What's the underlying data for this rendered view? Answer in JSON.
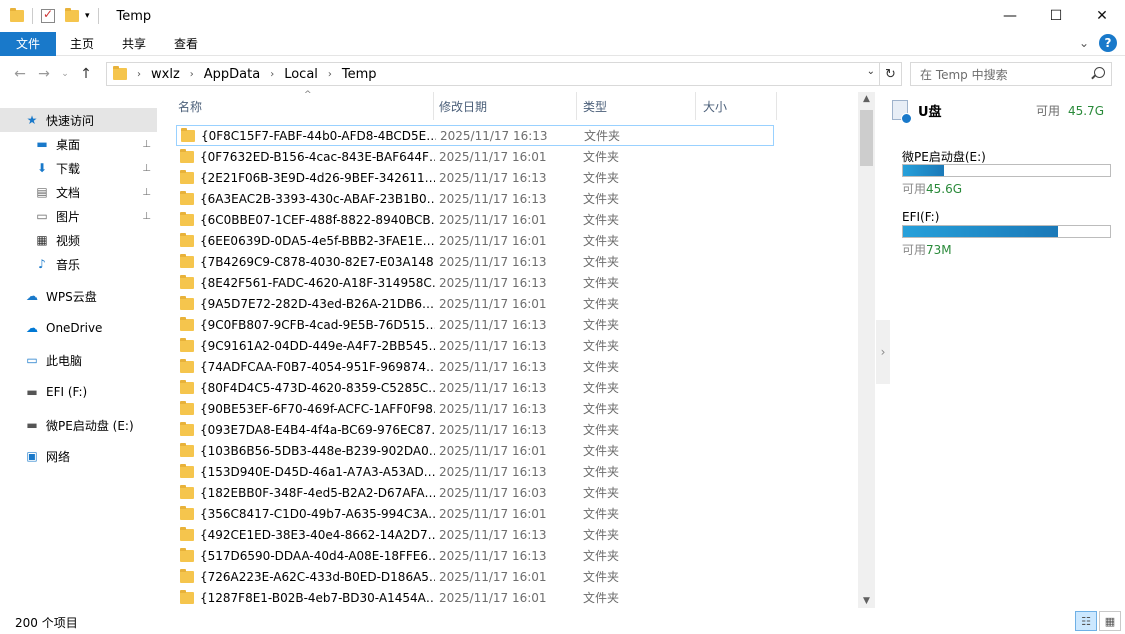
{
  "window": {
    "title": "Temp",
    "controls": {
      "minimize": "—",
      "maximize": "☐",
      "close": "✕"
    }
  },
  "ribbon": {
    "tabs": [
      {
        "label": "文件",
        "active": true
      },
      {
        "label": "主页"
      },
      {
        "label": "共享"
      },
      {
        "label": "查看"
      }
    ],
    "expand_glyph": "⌄",
    "help": "?"
  },
  "nav": {
    "back": "←",
    "forward": "→",
    "recent": "⌄",
    "up": "↑",
    "breadcrumb": [
      "wxlz",
      "AppData",
      "Local",
      "Temp"
    ],
    "breadcrumb_sep": "›",
    "refresh": "↻",
    "search_placeholder": "在 Temp 中搜索"
  },
  "sidebar": {
    "items": [
      {
        "label": "快速访问",
        "icon": "star-icon",
        "glyph": "★",
        "color": "#1979ca",
        "selected": true
      },
      {
        "label": "桌面",
        "icon": "desktop-icon",
        "glyph": "▬",
        "color": "#1979ca",
        "pinned": true
      },
      {
        "label": "下载",
        "icon": "download-icon",
        "glyph": "⬇",
        "color": "#1979ca",
        "pinned": true
      },
      {
        "label": "文档",
        "icon": "document-icon",
        "glyph": "▤",
        "color": "#666666",
        "pinned": true
      },
      {
        "label": "图片",
        "icon": "pictures-icon",
        "glyph": "▭",
        "color": "#666666",
        "pinned": true
      },
      {
        "label": "视频",
        "icon": "video-icon",
        "glyph": "▦",
        "color": "#333333"
      },
      {
        "label": "音乐",
        "icon": "music-icon",
        "glyph": "♪",
        "color": "#1979ca"
      },
      {
        "label": "WPS云盘",
        "icon": "cloud-icon",
        "glyph": "☁",
        "color": "#1979ca"
      },
      {
        "label": "OneDrive",
        "icon": "onedrive-icon",
        "glyph": "☁",
        "color": "#0078d4"
      },
      {
        "label": "此电脑",
        "icon": "computer-icon",
        "glyph": "▭",
        "color": "#1979ca"
      },
      {
        "label": "EFI (F:)",
        "icon": "drive-icon",
        "glyph": "▬",
        "color": "#555555"
      },
      {
        "label": "微PE启动盘 (E:)",
        "icon": "drive-icon",
        "glyph": "▬",
        "color": "#555555"
      },
      {
        "label": "网络",
        "icon": "network-icon",
        "glyph": "▣",
        "color": "#1979ca"
      }
    ],
    "pin_glyph": "📌"
  },
  "columns": {
    "name": "名称",
    "date": "修改日期",
    "type": "类型",
    "size": "大小"
  },
  "files": [
    {
      "name": "{0F8C15F7-FABF-44b0-AFD8-4BCD5E…",
      "date": "2025/11/17 16:13",
      "type": "文件夹"
    },
    {
      "name": "{0F7632ED-B156-4cac-843E-BAF644F…",
      "date": "2025/11/17 16:01",
      "type": "文件夹"
    },
    {
      "name": "{2E21F06B-3E9D-4d26-9BEF-342611…",
      "date": "2025/11/17 16:13",
      "type": "文件夹"
    },
    {
      "name": "{6A3EAC2B-3393-430c-ABAF-23B1B0…",
      "date": "2025/11/17 16:13",
      "type": "文件夹"
    },
    {
      "name": "{6C0BBE07-1CEF-488f-8822-8940BCB…",
      "date": "2025/11/17 16:01",
      "type": "文件夹"
    },
    {
      "name": "{6EE0639D-0DA5-4e5f-BBB2-3FAE1E…",
      "date": "2025/11/17 16:01",
      "type": "文件夹"
    },
    {
      "name": "{7B4269C9-C878-4030-82E7-E03A148…",
      "date": "2025/11/17 16:13",
      "type": "文件夹"
    },
    {
      "name": "{8E42F561-FADC-4620-A18F-314958C…",
      "date": "2025/11/17 16:13",
      "type": "文件夹"
    },
    {
      "name": "{9A5D7E72-282D-43ed-B26A-21DB6…",
      "date": "2025/11/17 16:01",
      "type": "文件夹"
    },
    {
      "name": "{9C0FB807-9CFB-4cad-9E5B-76D515…",
      "date": "2025/11/17 16:13",
      "type": "文件夹"
    },
    {
      "name": "{9C9161A2-04DD-449e-A4F7-2BB545…",
      "date": "2025/11/17 16:13",
      "type": "文件夹"
    },
    {
      "name": "{74ADFCAA-F0B7-4054-951F-969874…",
      "date": "2025/11/17 16:13",
      "type": "文件夹"
    },
    {
      "name": "{80F4D4C5-473D-4620-8359-C5285C…",
      "date": "2025/11/17 16:13",
      "type": "文件夹"
    },
    {
      "name": "{90BE53EF-6F70-469f-ACFC-1AFF0F98…",
      "date": "2025/11/17 16:13",
      "type": "文件夹"
    },
    {
      "name": "{093E7DA8-E4B4-4f4a-BC69-976EC87…",
      "date": "2025/11/17 16:13",
      "type": "文件夹"
    },
    {
      "name": "{103B6B56-5DB3-448e-B239-902DA0…",
      "date": "2025/11/17 16:01",
      "type": "文件夹"
    },
    {
      "name": "{153D940E-D45D-46a1-A7A3-A53AD…",
      "date": "2025/11/17 16:13",
      "type": "文件夹"
    },
    {
      "name": "{182EBB0F-348F-4ed5-B2A2-D67AFA…",
      "date": "2025/11/17 16:03",
      "type": "文件夹"
    },
    {
      "name": "{356C8417-C1D0-49b7-A635-994C3A…",
      "date": "2025/11/17 16:01",
      "type": "文件夹"
    },
    {
      "name": "{492CE1ED-38E3-40e4-8662-14A2D7…",
      "date": "2025/11/17 16:13",
      "type": "文件夹"
    },
    {
      "name": "{517D6590-DDAA-40d4-A08E-18FFE6…",
      "date": "2025/11/17 16:13",
      "type": "文件夹"
    },
    {
      "name": "{726A223E-A62C-433d-B0ED-D186A5…",
      "date": "2025/11/17 16:01",
      "type": "文件夹"
    },
    {
      "name": "{1287F8E1-B02B-4eb7-BD30-A1454A…",
      "date": "2025/11/17 16:01",
      "type": "文件夹"
    }
  ],
  "preview": {
    "drive_name": "U盘",
    "drive_free_label": "可用",
    "drive_free_value": "45.7G",
    "drives": [
      {
        "name": "微PE启动盘(E:)",
        "free_label": "可用",
        "free_value": "45.6G",
        "used_fraction": 0.2
      },
      {
        "name": "EFI(F:)",
        "free_label": "可用",
        "free_value": "73M",
        "used_fraction": 0.75
      }
    ],
    "collapse_glyph": "›"
  },
  "status": {
    "count": "200 个项目"
  },
  "views": {
    "details": "☷",
    "large_icons": "▦"
  }
}
